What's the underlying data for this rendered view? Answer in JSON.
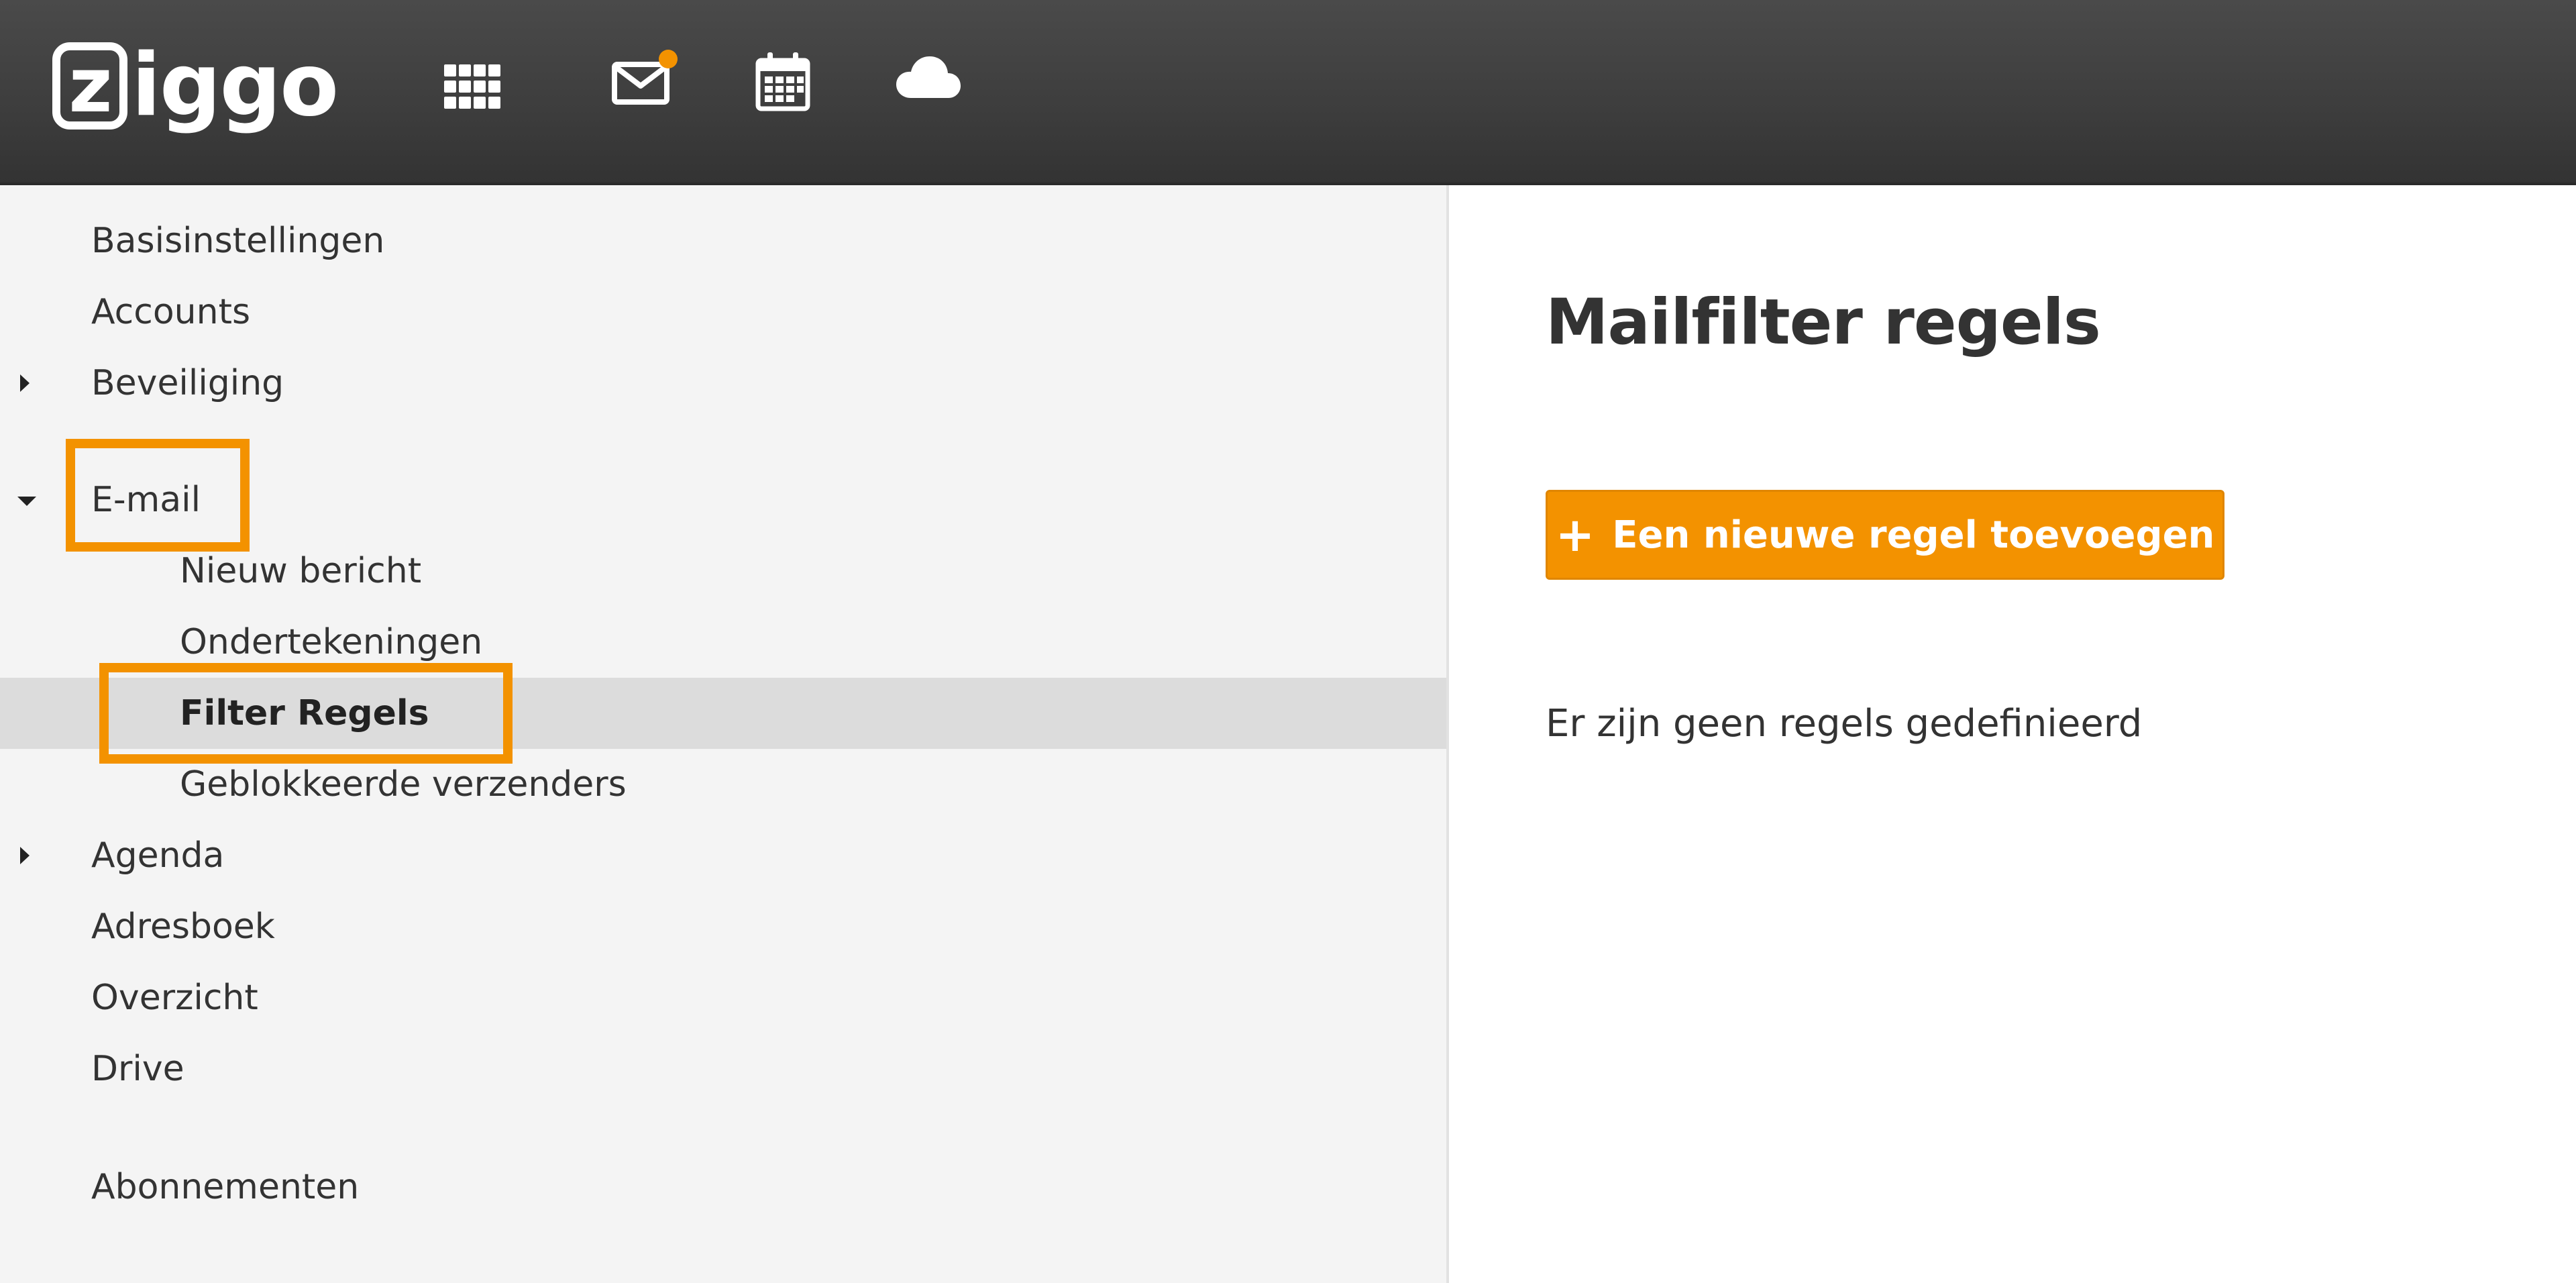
{
  "header": {
    "logo_text": "ziggo",
    "logo_letter": "z",
    "logo_rest": "iggo",
    "icons": [
      "apps-grid-icon",
      "mail-icon",
      "calendar-icon",
      "cloud-icon"
    ],
    "mail_notification": true
  },
  "colors": {
    "accent": "#f39200",
    "topbar": "#3d3d3d",
    "sidebar_bg": "#f4f4f4",
    "active_row": "#dcdcdc",
    "text": "#333333"
  },
  "sidebar": {
    "items": [
      {
        "label": "Basisinstellingen"
      },
      {
        "label": "Accounts"
      },
      {
        "label": "Beveiliging"
      },
      {
        "label": "E-mail"
      },
      {
        "label": "Nieuw bericht"
      },
      {
        "label": "Ondertekeningen"
      },
      {
        "label": "Filter Regels"
      },
      {
        "label": "Geblokkeerde verzenders"
      },
      {
        "label": "Agenda"
      },
      {
        "label": "Adresboek"
      },
      {
        "label": "Overzicht"
      },
      {
        "label": "Drive"
      },
      {
        "label": "Abonnementen"
      }
    ]
  },
  "main": {
    "title": "Mailfilter regels",
    "add_button_label": "Een nieuwe regel toevoegen",
    "add_button_symbol": "+",
    "empty_message": "Er zijn geen regels gedefinieerd"
  }
}
